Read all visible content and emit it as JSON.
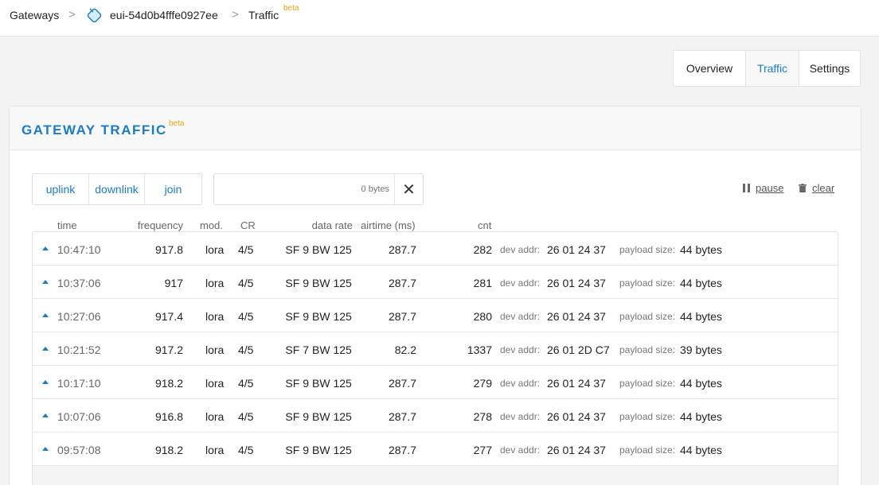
{
  "breadcrumb": {
    "gateways": "Gateways",
    "gateway_id": "eui-54d0b4fffe0927ee",
    "traffic": "Traffic",
    "beta": "beta",
    "sep": ">"
  },
  "tabs": [
    {
      "label": "Overview"
    },
    {
      "label": "Traffic"
    },
    {
      "label": "Settings"
    }
  ],
  "panel": {
    "title": "GATEWAY TRAFFIC",
    "beta": "beta"
  },
  "filters": {
    "uplink": "uplink",
    "downlink": "downlink",
    "join": "join"
  },
  "search": {
    "placeholder": "0 bytes",
    "clear_icon": "✕"
  },
  "controls": {
    "pause": "pause",
    "clear": "clear"
  },
  "columns": {
    "time": "time",
    "frequency": "frequency",
    "mod": "mod.",
    "cr": "CR",
    "data_rate": "data rate",
    "airtime": "airtime (ms)",
    "cnt": "cnt"
  },
  "labels": {
    "dev_addr": "dev addr:",
    "payload_size": "payload size:"
  },
  "rows": [
    {
      "time": "10:47:10",
      "frequency": "917.8",
      "mod": "lora",
      "cr": "4/5",
      "sf": "SF 9",
      "bw": "BW 125",
      "airtime": "287.7",
      "cnt": "282",
      "dev_addr": "26 01 24 37",
      "payload": "44 bytes"
    },
    {
      "time": "10:37:06",
      "frequency": "917",
      "mod": "lora",
      "cr": "4/5",
      "sf": "SF 9",
      "bw": "BW 125",
      "airtime": "287.7",
      "cnt": "281",
      "dev_addr": "26 01 24 37",
      "payload": "44 bytes"
    },
    {
      "time": "10:27:06",
      "frequency": "917.4",
      "mod": "lora",
      "cr": "4/5",
      "sf": "SF 9",
      "bw": "BW 125",
      "airtime": "287.7",
      "cnt": "280",
      "dev_addr": "26 01 24 37",
      "payload": "44 bytes"
    },
    {
      "time": "10:21:52",
      "frequency": "917.2",
      "mod": "lora",
      "cr": "4/5",
      "sf": "SF 7",
      "bw": "BW 125",
      "airtime": "82.2",
      "cnt": "1337",
      "dev_addr": "26 01 2D C7",
      "payload": "39 bytes"
    },
    {
      "time": "10:17:10",
      "frequency": "918.2",
      "mod": "lora",
      "cr": "4/5",
      "sf": "SF 9",
      "bw": "BW 125",
      "airtime": "287.7",
      "cnt": "279",
      "dev_addr": "26 01 24 37",
      "payload": "44 bytes"
    },
    {
      "time": "10:07:06",
      "frequency": "916.8",
      "mod": "lora",
      "cr": "4/5",
      "sf": "SF 9",
      "bw": "BW 125",
      "airtime": "287.7",
      "cnt": "278",
      "dev_addr": "26 01 24 37",
      "payload": "44 bytes"
    },
    {
      "time": "09:57:08",
      "frequency": "918.2",
      "mod": "lora",
      "cr": "4/5",
      "sf": "SF 9",
      "bw": "BW 125",
      "airtime": "287.7",
      "cnt": "277",
      "dev_addr": "26 01 24 37",
      "payload": "44 bytes"
    }
  ],
  "colors": {
    "accent": "#1a7cc9",
    "beta": "#e8a317"
  }
}
